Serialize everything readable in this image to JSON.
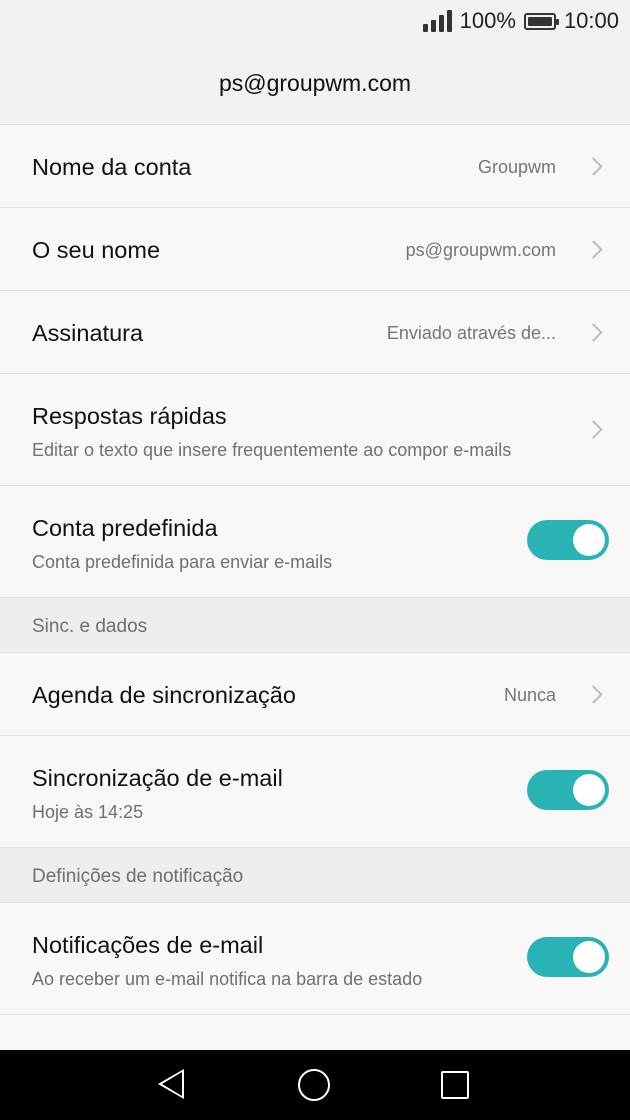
{
  "status_bar": {
    "battery_percent": "100%",
    "time": "10:00",
    "battery_level": 1.0
  },
  "header": {
    "title": "ps@groupwm.com"
  },
  "rows": {
    "account_name": {
      "label": "Nome da conta",
      "value": "Groupwm"
    },
    "your_name": {
      "label": "O seu nome",
      "value": "ps@groupwm.com"
    },
    "signature": {
      "label": "Assinatura",
      "value": "Enviado através de..."
    },
    "quick_responses": {
      "label": "Respostas rápidas",
      "sub": "Editar o texto que insere frequentemente ao compor e-mails"
    },
    "default_account": {
      "label": "Conta predefinida",
      "sub": "Conta predefinida para enviar e-mails",
      "toggle_on": true
    },
    "sync_section": {
      "label": "Sinc. e dados"
    },
    "sync_schedule": {
      "label": "Agenda de sincronização",
      "value": "Nunca"
    },
    "email_sync": {
      "label": "Sincronização de e-mail",
      "sub": "Hoje às 14:25",
      "toggle_on": true
    },
    "notification_section": {
      "label": "Definições de notificação"
    },
    "email_notifications": {
      "label": "Notificações de e-mail",
      "sub": "Ao receber um e-mail notifica na barra de estado",
      "toggle_on": true
    }
  },
  "colors": {
    "accent": "#2ab3b4",
    "background": "#f8f8f8",
    "section": "#eeeeee"
  },
  "nav_bar": {
    "icons": [
      "back-icon",
      "home-icon",
      "recents-icon"
    ]
  }
}
